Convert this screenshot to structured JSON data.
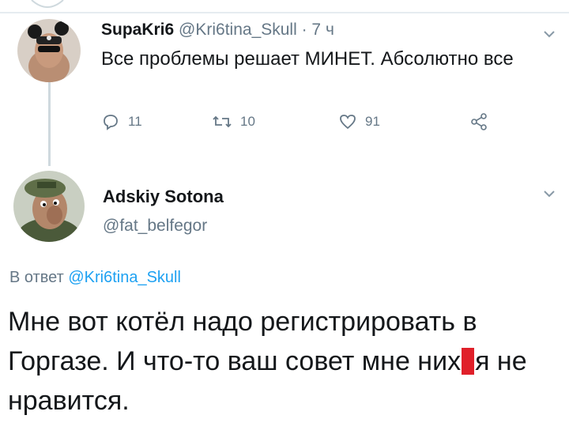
{
  "tweet1": {
    "name": "SupaKri6",
    "handle": "@Kri6tina_Skull",
    "time": "· 7 ч",
    "text": "Все проблемы решает МИНЕТ. Абсолютно все",
    "reply_count": "11",
    "retweet_count": "10",
    "like_count": "91"
  },
  "tweet2": {
    "name": "Adskiy Sotona",
    "handle": "@fat_belfegor",
    "reply_prefix": "В ответ",
    "reply_handle": "@Kri6tina_Skull",
    "text_before": "Мне вот котёл надо регистрировать в Горгазе. И что-то ваш совет мне них",
    "text_after": "я не нравится."
  },
  "colors": {
    "text": "#14171a",
    "muted": "#657786",
    "link": "#1da1f2",
    "censor": "#e0202a"
  },
  "icons": [
    "reply-icon",
    "retweet-icon",
    "like-icon",
    "share-icon",
    "chevron-down-icon"
  ]
}
